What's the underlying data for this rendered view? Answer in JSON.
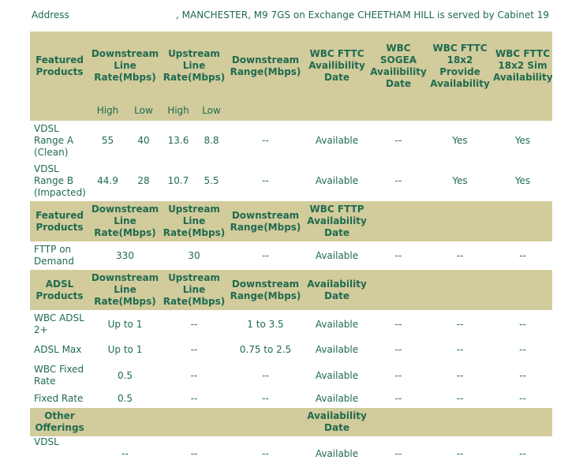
{
  "address": {
    "label": "Address",
    "text": ", MANCHESTER, M9 7GS on Exchange CHEETHAM HILL is served by Cabinet 19"
  },
  "fttc_header": {
    "featured": "Featured Products",
    "downstream": "Downstream Line Rate(Mbps)",
    "upstream": "Upstream Line Rate(Mbps)",
    "range": "Downstream Range(Mbps)",
    "availability": "WBC FTTC Availibility Date",
    "sogea": "WBC SOGEA Availibility Date",
    "provide": "WBC FTTC 18x2 Provide Availability",
    "sim": "WBC FTTC 18x2 Sim Availability"
  },
  "subheader": {
    "high": "High",
    "low": "Low"
  },
  "vdsl_rows": [
    {
      "name": "VDSL Range A (Clean)",
      "down_high": "55",
      "down_low": "40",
      "up_high": "13.6",
      "up_low": "8.8",
      "range": "--",
      "availability": "Available",
      "sogea": "--",
      "provide": "Yes",
      "sim": "Yes"
    },
    {
      "name": "VDSL Range B (Impacted)",
      "down_high": "44.9",
      "down_low": "28",
      "up_high": "10.7",
      "up_low": "5.5",
      "range": "--",
      "availability": "Available",
      "sogea": "--",
      "provide": "Yes",
      "sim": "Yes"
    }
  ],
  "fttp_header": {
    "featured": "Featured Products",
    "downstream": "Downstream Line Rate(Mbps)",
    "upstream": "Upstream Line Rate(Mbps)",
    "range": "Downstream Range(Mbps)",
    "availability": "WBC FTTP Availability Date"
  },
  "fttp_rows": [
    {
      "name": "FTTP on Demand",
      "down": "330",
      "up": "30",
      "range": "--",
      "availability": "Available",
      "c6": "--",
      "c7": "--",
      "c8": "--"
    }
  ],
  "adsl_header": {
    "products": "ADSL Products",
    "downstream": "Downstream Line Rate(Mbps)",
    "upstream": "Upstream Line Rate(Mbps)",
    "range": "Downstream Range(Mbps)",
    "availability": "Availability Date"
  },
  "adsl_rows": [
    {
      "name": "WBC ADSL 2+",
      "down": "Up to 1",
      "up": "--",
      "range": "1 to 3.5",
      "availability": "Available",
      "c6": "--",
      "c7": "--",
      "c8": "--"
    },
    {
      "name": "ADSL Max",
      "down": "Up to 1",
      "up": "--",
      "range": "0.75 to 2.5",
      "availability": "Available",
      "c6": "--",
      "c7": "--",
      "c8": "--"
    },
    {
      "name": "WBC Fixed Rate",
      "down": "0.5",
      "up": "--",
      "range": "--",
      "availability": "Available",
      "c6": "--",
      "c7": "--",
      "c8": "--"
    },
    {
      "name": "Fixed Rate",
      "down": "0.5",
      "up": "--",
      "range": "--",
      "availability": "Available",
      "c6": "--",
      "c7": "--",
      "c8": "--"
    }
  ],
  "other_header": {
    "offerings": "Other Offerings",
    "availability": "Availability Date"
  },
  "other_rows": [
    {
      "name": "VDSL",
      "down": "--",
      "up": "--",
      "range": "--",
      "availability": "Available",
      "c6": "--",
      "c7": "--",
      "c8": "--"
    }
  ]
}
